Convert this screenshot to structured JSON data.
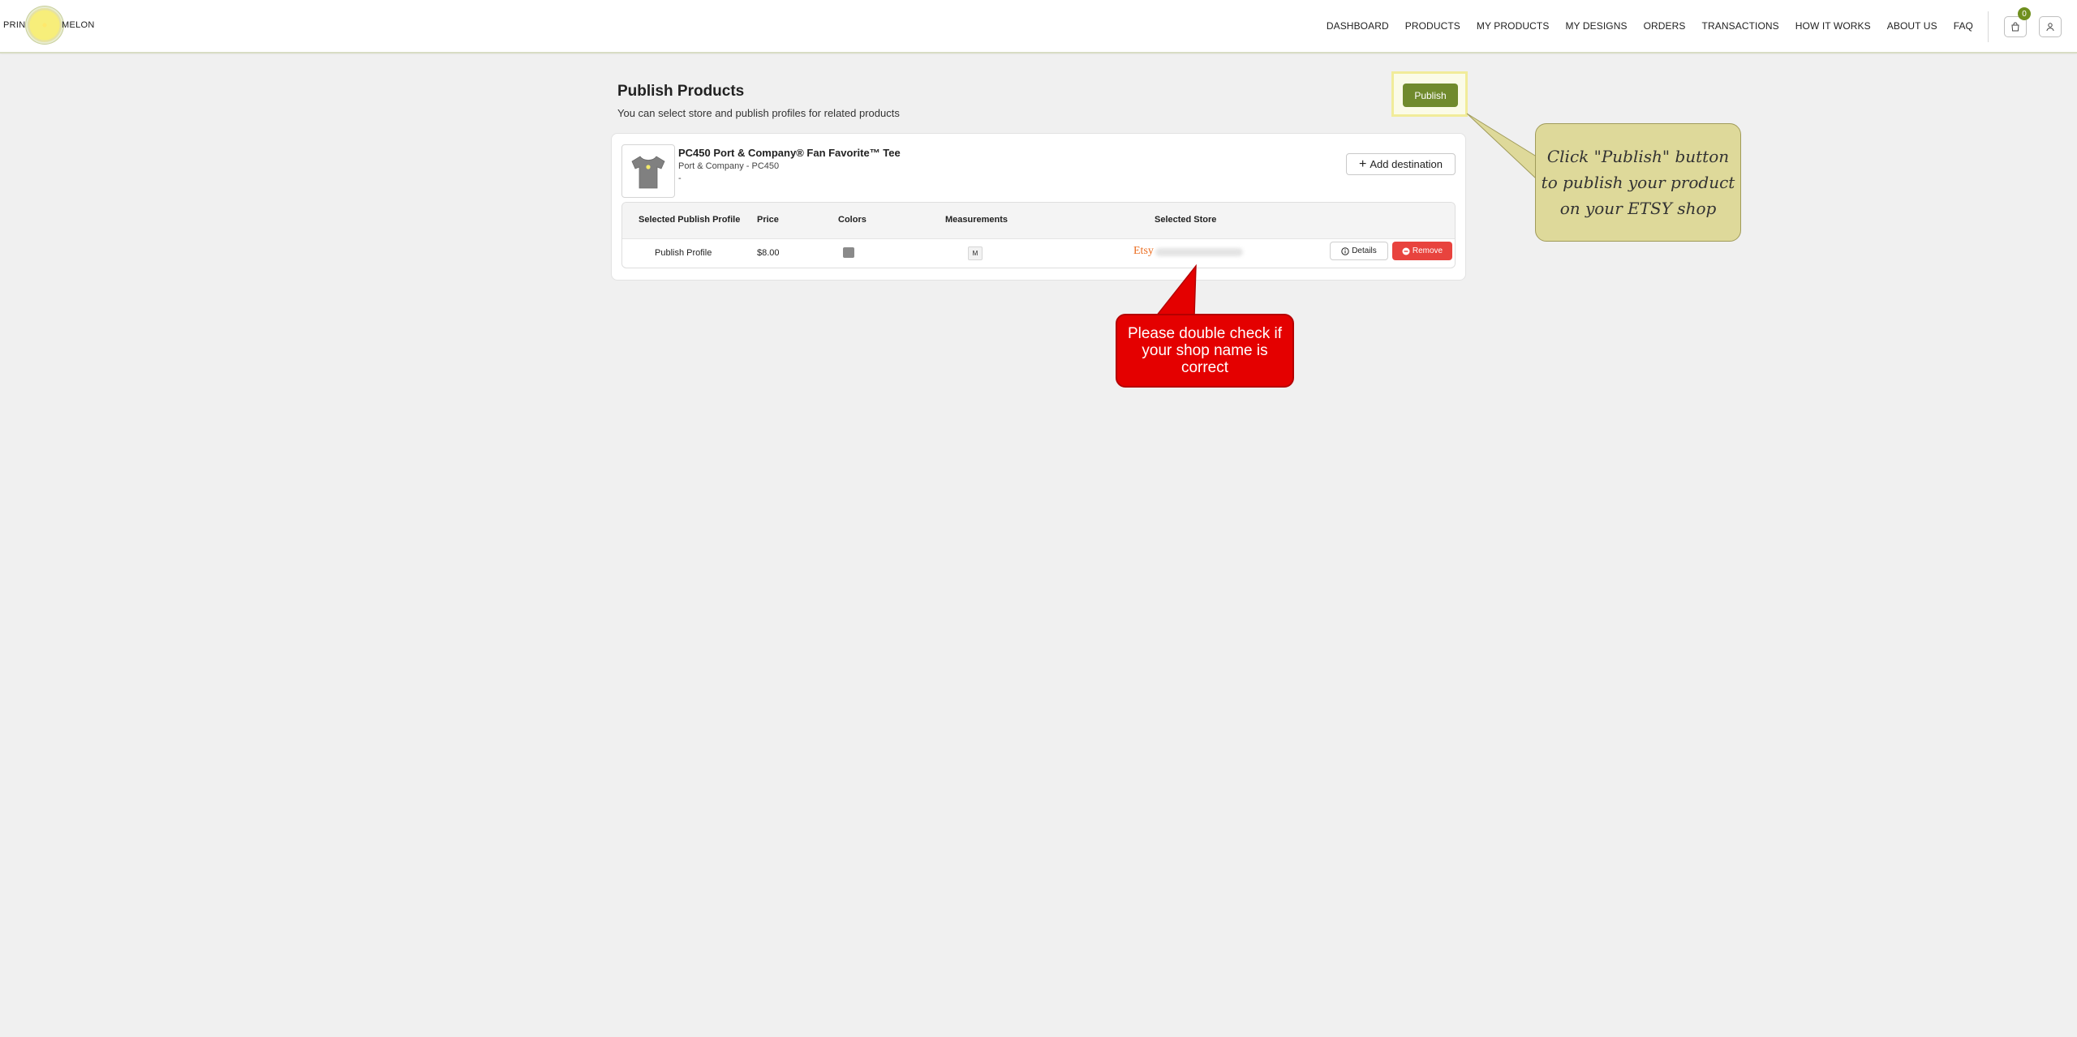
{
  "header": {
    "logo_left": "PRINT",
    "logo_right": "MELON",
    "nav": [
      "DASHBOARD",
      "PRODUCTS",
      "MY PRODUCTS",
      "MY DESIGNS",
      "ORDERS",
      "TRANSACTIONS",
      "HOW IT WORKS",
      "ABOUT US",
      "FAQ"
    ],
    "cart_count": "0",
    "cart_icon": "shopping-bag-icon",
    "user_icon": "user-icon"
  },
  "page": {
    "title": "Publish Products",
    "subtitle": "You can select store and publish profiles for related products",
    "publish_label": "Publish"
  },
  "product": {
    "name": "PC450 Port & Company® Fan Favorite™ Tee",
    "brand": "Port & Company - PC450",
    "extra": "-",
    "add_destination_label": "Add destination",
    "thumbnail_icon": "tshirt-icon"
  },
  "table": {
    "headers": [
      "Selected Publish Profile",
      "Price",
      "Colors",
      "Measurements",
      "Selected Store"
    ],
    "rows": [
      {
        "profile": "Publish Profile",
        "price": "$8.00",
        "color": "#8a8a8a",
        "measurement": "M",
        "store_platform": "Etsy",
        "details_label": "Details",
        "remove_label": "Remove"
      }
    ]
  },
  "callouts": {
    "publish_tip": "Click \"Publish\" button to publish your product on your ETSY shop",
    "shop_tip": "Please double check if your shop name is correct"
  },
  "colors": {
    "accent": "#708a2d",
    "danger": "#e8433e",
    "etsy": "#eb6d20",
    "callout_yellow": "#ded99a",
    "callout_red": "#e40000"
  }
}
